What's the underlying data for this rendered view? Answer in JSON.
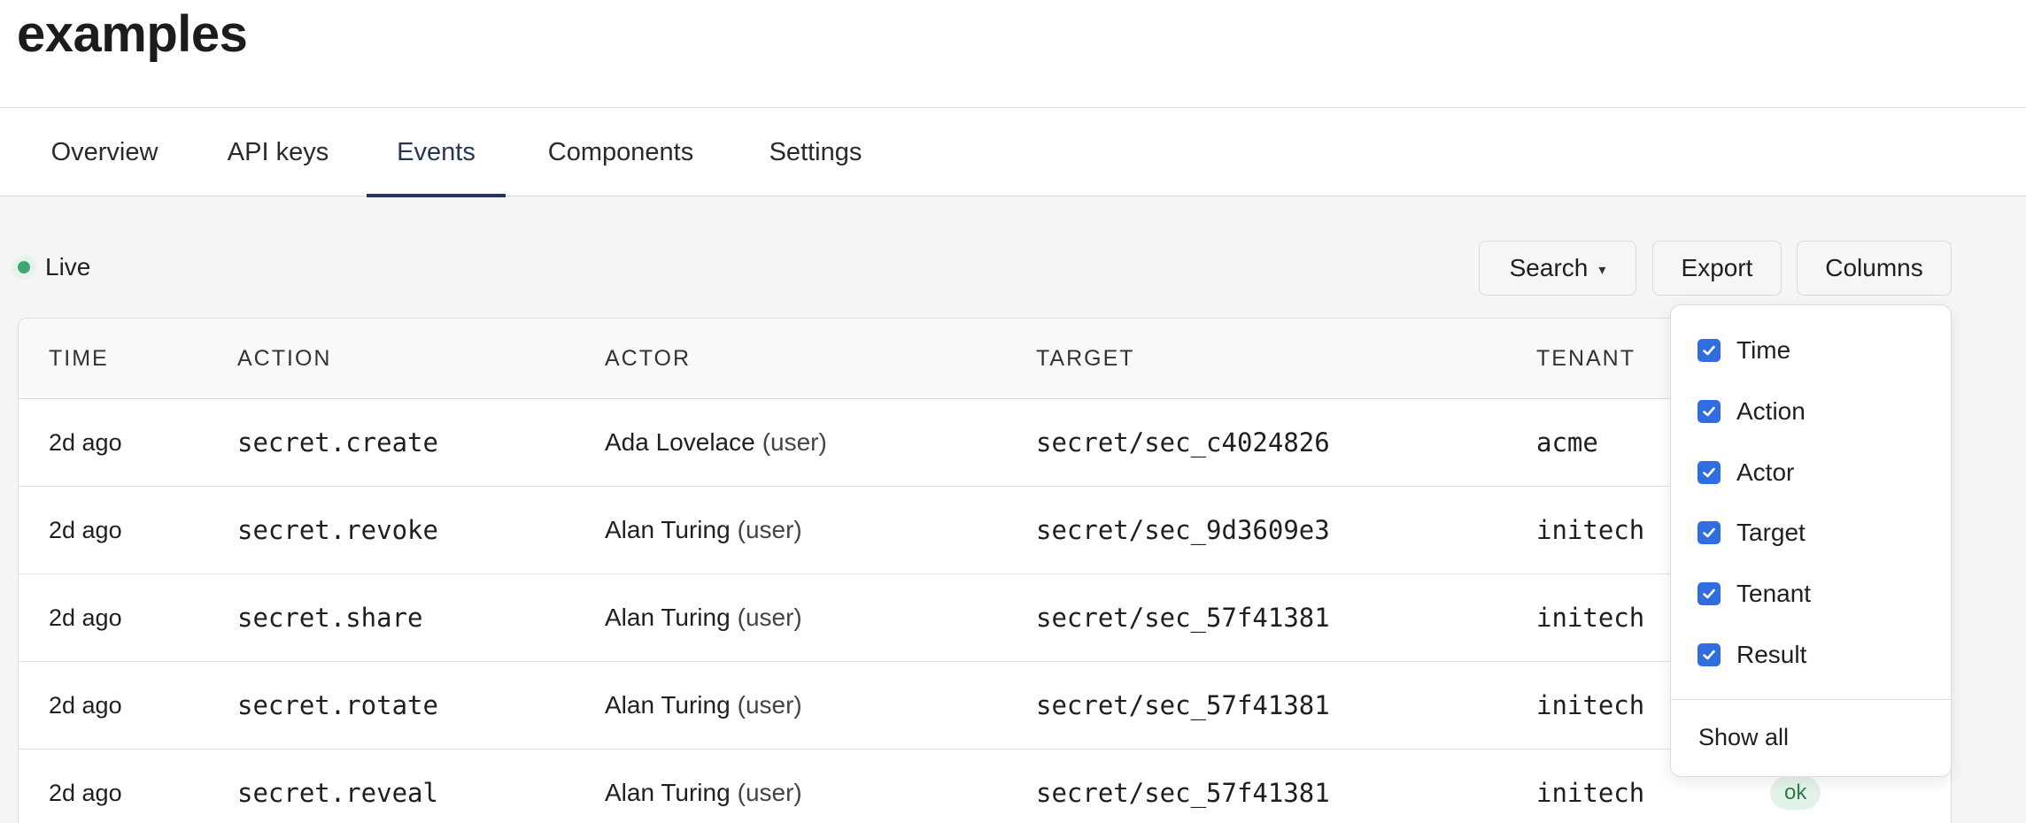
{
  "page": {
    "title": "examples"
  },
  "tabs": [
    {
      "label": "Overview",
      "active": false
    },
    {
      "label": "API keys",
      "active": false
    },
    {
      "label": "Events",
      "active": true
    },
    {
      "label": "Components",
      "active": false
    },
    {
      "label": "Settings",
      "active": false
    }
  ],
  "toolbar": {
    "live_label": "Live",
    "search_label": "Search",
    "caret": "▾",
    "export_label": "Export",
    "columns_label": "Columns"
  },
  "table": {
    "headers": [
      "TIME",
      "ACTION",
      "ACTOR",
      "TARGET",
      "TENANT"
    ],
    "rows": [
      {
        "time": "2d ago",
        "action": "secret.create",
        "actor": "Ada Lovelace",
        "role": "(user)",
        "target": "secret/sec_c4024826",
        "tenant": "acme",
        "result": ""
      },
      {
        "time": "2d ago",
        "action": "secret.revoke",
        "actor": "Alan Turing",
        "role": "(user)",
        "target": "secret/sec_9d3609e3",
        "tenant": "initech",
        "result": ""
      },
      {
        "time": "2d ago",
        "action": "secret.share",
        "actor": "Alan Turing",
        "role": "(user)",
        "target": "secret/sec_57f41381",
        "tenant": "initech",
        "result": ""
      },
      {
        "time": "2d ago",
        "action": "secret.rotate",
        "actor": "Alan Turing",
        "role": "(user)",
        "target": "secret/sec_57f41381",
        "tenant": "initech",
        "result": ""
      },
      {
        "time": "2d ago",
        "action": "secret.reveal",
        "actor": "Alan Turing",
        "role": "(user)",
        "target": "secret/sec_57f41381",
        "tenant": "initech",
        "result": "ok"
      }
    ]
  },
  "columns_menu": {
    "items": [
      {
        "label": "Time",
        "checked": true
      },
      {
        "label": "Action",
        "checked": true
      },
      {
        "label": "Actor",
        "checked": true
      },
      {
        "label": "Target",
        "checked": true
      },
      {
        "label": "Tenant",
        "checked": true
      },
      {
        "label": "Result",
        "checked": true
      }
    ],
    "show_all_label": "Show all"
  },
  "colors": {
    "accent": "#25365a",
    "checkbox": "#2f6de1",
    "live_dot": "#3ea874",
    "ok_badge_bg": "#e4f3e9",
    "ok_badge_text": "#2f7d4a"
  }
}
